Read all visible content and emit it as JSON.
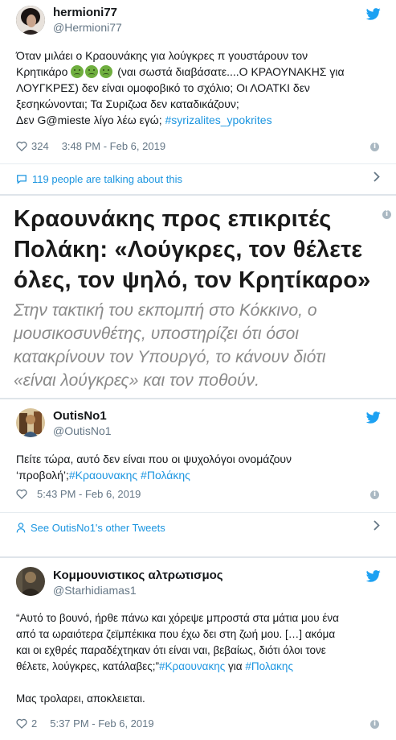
{
  "tweet1": {
    "name": "hermioni77",
    "handle": "@Hermioni77",
    "line1": "Όταν μιλάει ο Κραουνάκης για λούγκρες π γουστάρουν τον",
    "line2_a": "Κρητικάρο",
    "line2_b": "(ναι σωστά διαβάσατε....Ο ΚΡΑΟΥΝΑΚΗΣ για",
    "line3": "ΛΟΥΓΚΡΕΣ) δεν είναι ομοφοβικό το σχόλιο; Οι ΛΟΑΤΚΙ δεν",
    "line4": "ξεσηκώνονται; Τα Συριζωα δεν καταδικάζουν;",
    "line5_a": "Δεν G@mieste λίγο λέω εγώ;",
    "hashtag": "#syrizalites_ypokrites",
    "likes": "324",
    "timestamp": "3:48 PM - Feb 6, 2019",
    "talking": "119 people are talking about this"
  },
  "article": {
    "headline_1": "Κραουνάκης προς επικριτές",
    "headline_2": "Πολάκη: «Λούγκρες, τον θέλετε",
    "headline_3": "όλες, τον ψηλό, τον Κρητίκαρο»",
    "sub_1": "Στην τακτική του εκπομπή στο Κόκκινο, ο",
    "sub_2": "μουσικοσυνθέτης, υποστηρίζει ότι όσοι",
    "sub_3": "κατακρίνουν τον Υπουργό, το κάνουν διότι",
    "sub_4": "«είναι λούγκρες» και τον ποθούν."
  },
  "tweet2": {
    "name": "OutisNo1",
    "handle": "@OutisNo1",
    "line1": "Πείτε τώρα, αυτό δεν είναι που οι ψυχολόγοι ονομάζουν",
    "line2_a": "‘προβολή’;",
    "hashtag1": "#Κραουνακης",
    "hashtag2": "#Πολάκης",
    "timestamp": "5:43 PM - Feb 6, 2019",
    "other_tweets": "See OutisNo1's other Tweets"
  },
  "tweet3": {
    "name": "Κομμουνιστικος αλτρωτισμος",
    "handle": "@Starhidiamas1",
    "line1": "“Αυτό το βουνό, ήρθε πάνω και χόρεψε μπροστά στα μάτια μου  ένα",
    "line2": "από τα ωραιότερα ζεϊμπέκικα που έχω δει στη ζωή μου. […] ακόμα",
    "line3": "και οι εχθρές  παραδέχτηκαν ότι είναι ναι, βεβαίως, διότι όλοι τονε",
    "line4_a": "θέλετε, λούγκρες, κατάλαβες;”",
    "hashtag1": "#Κραουνακης",
    "line4_mid": "για",
    "hashtag2": "#Πολακης",
    "line5": "Μας τρολαρει, αποκλειεται.",
    "likes": "2",
    "timestamp": "5:37 PM - Feb 6, 2019"
  },
  "colors": {
    "twitter_blue": "#1da1f2",
    "link_blue": "#1b95e0",
    "muted": "#657786"
  }
}
